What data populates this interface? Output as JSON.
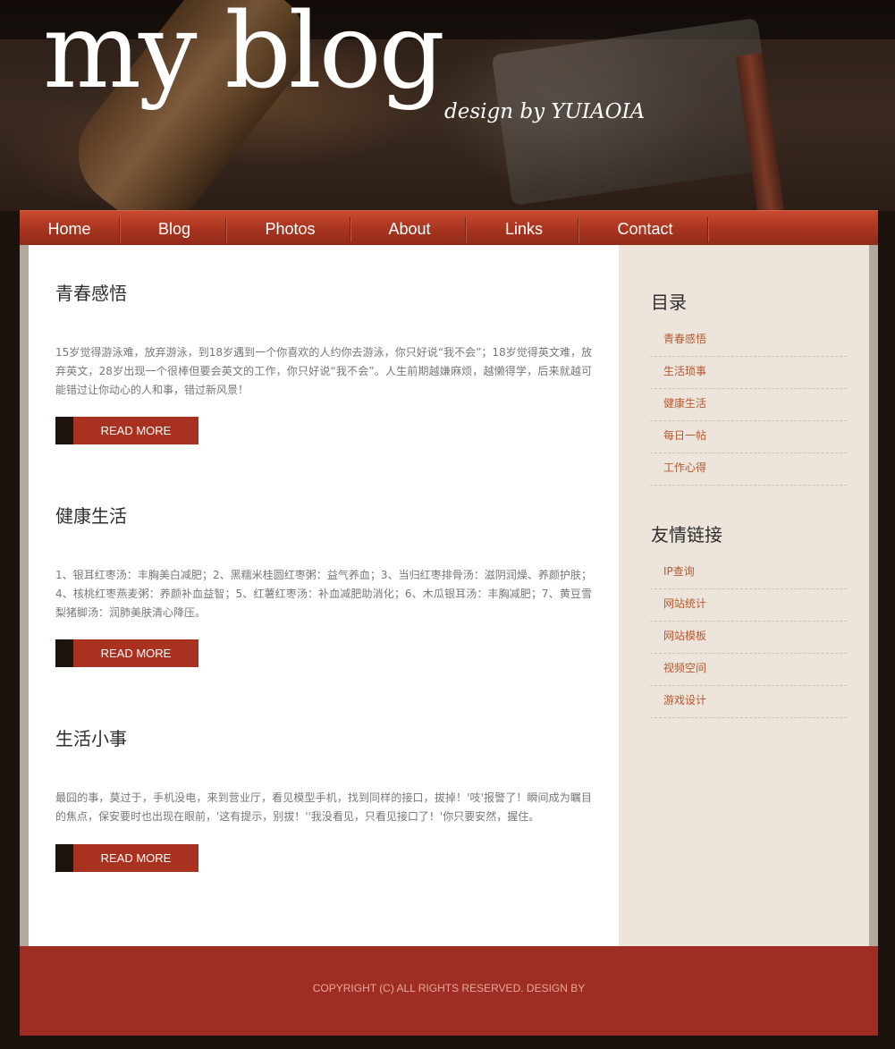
{
  "header": {
    "title": "my blog",
    "tagline": "design by YUIAOIA"
  },
  "nav": {
    "items": [
      {
        "label": "Home"
      },
      {
        "label": "Blog"
      },
      {
        "label": "Photos"
      },
      {
        "label": "About"
      },
      {
        "label": "Links"
      },
      {
        "label": "Contact"
      }
    ]
  },
  "posts": [
    {
      "title": "青春感悟",
      "body": "15岁觉得游泳难，放弃游泳，到18岁遇到一个你喜欢的人约你去游泳，你只好说“我不会”；18岁觉得英文难，放弃英文，28岁出现一个很棒但要会英文的工作，你只好说“我不会”。人生前期越嫌麻烦，越懒得学，后来就越可能错过让你动心的人和事，错过新风景！",
      "read_more": "READ MORE"
    },
    {
      "title": "健康生活",
      "body": "1、银耳红枣汤：丰胸美白减肥；2、黑糯米桂圆红枣粥：益气养血；3、当归红枣排骨汤：滋阴润燥、养颜护肤；4、核桃红枣燕麦粥：养颜补血益智；5、红薯红枣汤：补血减肥助消化；6、木瓜银耳汤：丰胸减肥；7、黄豆雪梨猪脚汤：润肺美肤清心降压。",
      "read_more": "READ MORE"
    },
    {
      "title": "生活小事",
      "body": "最囧的事，莫过于，手机没电，来到营业厅，看见模型手机，找到同样的接口，拔掉！'吱'报警了！瞬间成为瞩目的焦点，保安要时也出现在眼前，'这有提示，别拔！''我没看见，只看见接口了！'你只要安然，握住。",
      "read_more": "READ MORE"
    }
  ],
  "sidebar": {
    "catalog_title": "目录",
    "catalog": [
      "青春感悟",
      "生活琐事",
      "健康生活",
      "每日一帖",
      "工作心得"
    ],
    "links_title": "友情链接",
    "links": [
      "IP查询",
      "网站统计",
      "网站模板",
      "视频空间",
      "游戏设计"
    ]
  },
  "footer": {
    "copyright": "COPYRIGHT (C) ALL RIGHTS RESERVED. DESIGN BY"
  }
}
